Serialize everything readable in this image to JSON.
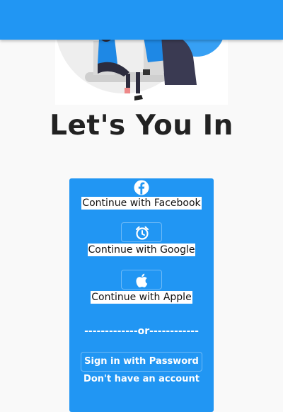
{
  "header": {
    "title": ""
  },
  "illustration": {
    "name": "people-sitting-illustration"
  },
  "page": {
    "title": "Let's You In"
  },
  "social": {
    "facebook": {
      "label": "Continue with Facebook",
      "icon": "facebook-icon"
    },
    "google": {
      "label": "Continue with Google",
      "icon": "alarm-clock-icon"
    },
    "apple": {
      "label": "Continue with Apple",
      "icon": "apple-icon"
    }
  },
  "divider": {
    "text": "-------------or------------"
  },
  "actions": {
    "password_label": "Sign in with Password",
    "signup_label": "Don't have an account"
  },
  "colors": {
    "primary": "#2196f3",
    "background": "#f9f9f9",
    "title": "#222222"
  }
}
